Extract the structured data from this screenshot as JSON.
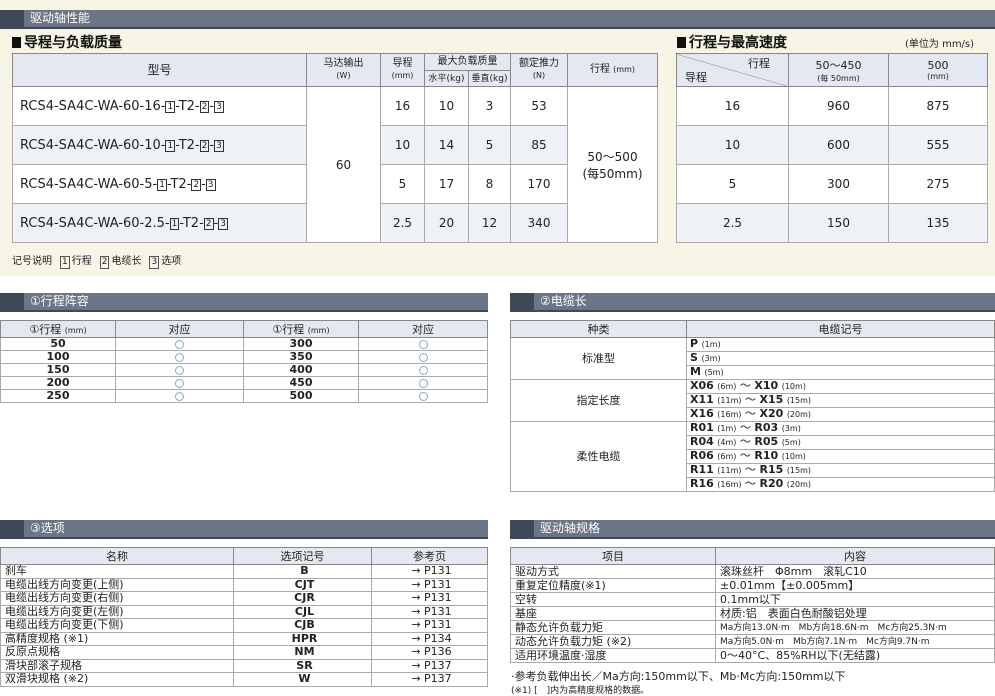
{
  "header": {
    "title": "驱动轴性能"
  },
  "sections": {
    "lead_payload": "导程与负载质量",
    "stroke_speed": "行程与最高速度",
    "speed_unit": "(单位为 mm/s)",
    "stroke_title": "①行程阵容",
    "cable_title": "②电缆长",
    "option_title": "③选项",
    "spec_title": "驱动轴规格"
  },
  "model_table": {
    "headers": {
      "model": "型号",
      "motor": "马达输出",
      "motor_unit": "(W)",
      "lead": "导程",
      "lead_unit": "(mm)",
      "payload": "最大负载质量",
      "horizontal": "水平(kg)",
      "vertical": "垂直(kg)",
      "thrust": "额定推力",
      "thrust_unit": "(N)",
      "stroke": "行程",
      "stroke_unit": "(mm)"
    },
    "motor_value": "60",
    "stroke_value": "50～500",
    "stroke_step": "(每50mm)",
    "rows": [
      {
        "prefix": "RCS4-SA4C-WA-60-16-",
        "m1": "1",
        "mid": "-T2-",
        "m2": "2",
        "dash": "-",
        "m3": "3",
        "lead": "16",
        "h": "10",
        "v": "3",
        "thrust": "53"
      },
      {
        "prefix": "RCS4-SA4C-WA-60-10-",
        "m1": "1",
        "mid": "-T2-",
        "m2": "2",
        "dash": "-",
        "m3": "3",
        "lead": "10",
        "h": "14",
        "v": "5",
        "thrust": "85"
      },
      {
        "prefix": "RCS4-SA4C-WA-60-5-",
        "m1": "1",
        "mid": "-T2-",
        "m2": "2",
        "dash": "-",
        "m3": "3",
        "lead": "5",
        "h": "17",
        "v": "8",
        "thrust": "170"
      },
      {
        "prefix": "RCS4-SA4C-WA-60-2.5-",
        "m1": "1",
        "mid": "-T2-",
        "m2": "2",
        "dash": "-",
        "m3": "3",
        "lead": "2.5",
        "h": "20",
        "v": "12",
        "thrust": "340"
      }
    ],
    "legend": {
      "label": "记号说明",
      "b1": "1",
      "t1": "行程",
      "b2": "2",
      "t2": "电缆长",
      "b3": "3",
      "t3": "选项"
    }
  },
  "speed_table": {
    "diag_top": "行程",
    "diag_bottom": "导程",
    "col1": "50～450",
    "col1_sub": "(每 50mm)",
    "col2": "500",
    "col2_sub": "(mm)",
    "rows": [
      {
        "lead": "16",
        "a": "960",
        "b": "875"
      },
      {
        "lead": "10",
        "a": "600",
        "b": "555"
      },
      {
        "lead": "5",
        "a": "300",
        "b": "275"
      },
      {
        "lead": "2.5",
        "a": "150",
        "b": "135"
      }
    ]
  },
  "stroke_table": {
    "h1": "①行程",
    "h_unit": "(mm)",
    "h2": "对应",
    "rows": [
      {
        "a": "50",
        "b": "300"
      },
      {
        "a": "100",
        "b": "350"
      },
      {
        "a": "150",
        "b": "400"
      },
      {
        "a": "200",
        "b": "450"
      },
      {
        "a": "250",
        "b": "500"
      }
    ]
  },
  "cable_table": {
    "h1": "种类",
    "h2": "电缆记号",
    "groups": [
      {
        "name": "标准型",
        "items": [
          {
            "c1": "P",
            "l1": "(1m)",
            "sep": "",
            "c2": "",
            "l2": ""
          },
          {
            "c1": "S",
            "l1": "(3m)",
            "sep": "",
            "c2": "",
            "l2": ""
          },
          {
            "c1": "M",
            "l1": "(5m)",
            "sep": "",
            "c2": "",
            "l2": ""
          }
        ]
      },
      {
        "name": "指定长度",
        "items": [
          {
            "c1": "X06",
            "l1": "(6m)",
            "sep": "～",
            "c2": "X10",
            "l2": "(10m)"
          },
          {
            "c1": "X11",
            "l1": "(11m)",
            "sep": "～",
            "c2": "X15",
            "l2": "(15m)"
          },
          {
            "c1": "X16",
            "l1": "(16m)",
            "sep": "～",
            "c2": "X20",
            "l2": "(20m)"
          }
        ]
      },
      {
        "name": "柔性电缆",
        "items": [
          {
            "c1": "R01",
            "l1": "(1m)",
            "sep": "～",
            "c2": "R03",
            "l2": "(3m)"
          },
          {
            "c1": "R04",
            "l1": "(4m)",
            "sep": "～",
            "c2": "R05",
            "l2": "(5m)"
          },
          {
            "c1": "R06",
            "l1": "(6m)",
            "sep": "～",
            "c2": "R10",
            "l2": "(10m)"
          },
          {
            "c1": "R11",
            "l1": "(11m)",
            "sep": "～",
            "c2": "R15",
            "l2": "(15m)"
          },
          {
            "c1": "R16",
            "l1": "(16m)",
            "sep": "～",
            "c2": "R20",
            "l2": "(20m)"
          }
        ]
      }
    ]
  },
  "option_table": {
    "h1": "名称",
    "h2": "选项记号",
    "h3": "参考页",
    "rows": [
      {
        "name": "刹车",
        "code": "B",
        "page": "→ P131"
      },
      {
        "name": "电缆出线方向变更(上侧)",
        "code": "CJT",
        "page": "→ P131"
      },
      {
        "name": "电缆出线方向变更(右侧)",
        "code": "CJR",
        "page": "→ P131"
      },
      {
        "name": "电缆出线方向变更(左侧)",
        "code": "CJL",
        "page": "→ P131"
      },
      {
        "name": "电缆出线方向变更(下侧)",
        "code": "CJB",
        "page": "→ P131"
      },
      {
        "name": "高精度规格 (※1)",
        "code": "HPR",
        "page": "→ P134"
      },
      {
        "name": "反原点规格",
        "code": "NM",
        "page": "→ P136"
      },
      {
        "name": "滑块部滚子规格",
        "code": "SR",
        "page": "→ P137"
      },
      {
        "name": "双滑块规格 (※2)",
        "code": "W",
        "page": "→ P137"
      }
    ]
  },
  "spec_table": {
    "h1": "项目",
    "h2": "内容",
    "rows": [
      {
        "item": "驱动方式",
        "value": "滚珠丝杆　Φ8mm　滚轧C10"
      },
      {
        "item": "重复定位精度(※1)",
        "value": "±0.01mm【±0.005mm】"
      },
      {
        "item": "空转",
        "value": "0.1mm以下"
      },
      {
        "item": "基座",
        "value": "材质:铝　表面白色耐酸铝处理"
      },
      {
        "item": "静态允许负载力矩",
        "value": "Ma方向13.0N·m　Mb方向18.6N·m　Mc方向25.3N·m"
      },
      {
        "item": "动态允许负载力矩 (※2)",
        "value": "Ma方向5.0N·m　Mb方向7.1N·m　Mc方向9.7N·m"
      },
      {
        "item": "适用环境温度·湿度",
        "value": "0～40°C、85%RH以下(无结露)"
      }
    ],
    "note1": "·参考负载伸出长／Ma方向:150mm以下、Mb·Mc方向:150mm以下",
    "note2": "(※1) [　]内为高精度规格的数据。"
  }
}
